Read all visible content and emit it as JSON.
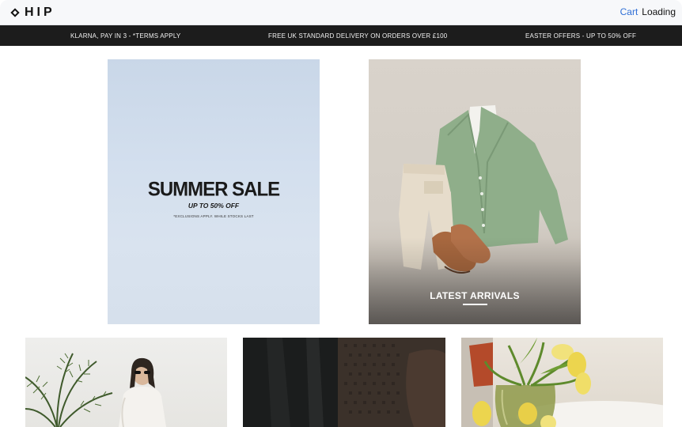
{
  "header": {
    "logo_text": "HIP",
    "cart_label": "Cart",
    "status_text": "Loading"
  },
  "announcement_bar": {
    "items": [
      "KLARNA, PAY IN 3 - *TERMS APPLY",
      "FREE UK STANDARD DELIVERY ON ORDERS OVER £100",
      "EASTER OFFERS - UP TO 50% OFF"
    ]
  },
  "hero": {
    "sale_tile": {
      "title": "SUMMER SALE",
      "subtitle": "UP TO 50% OFF",
      "note": "*EXCLUSIONS APPLY. WHILE STOCKS LAST"
    },
    "arrivals_tile": {
      "label": "LATEST ARRIVALS"
    }
  },
  "colors": {
    "announcement_bg": "#1c1c1c",
    "cart_link": "#2f6fd6",
    "sale_bg": "#d3dfee"
  }
}
